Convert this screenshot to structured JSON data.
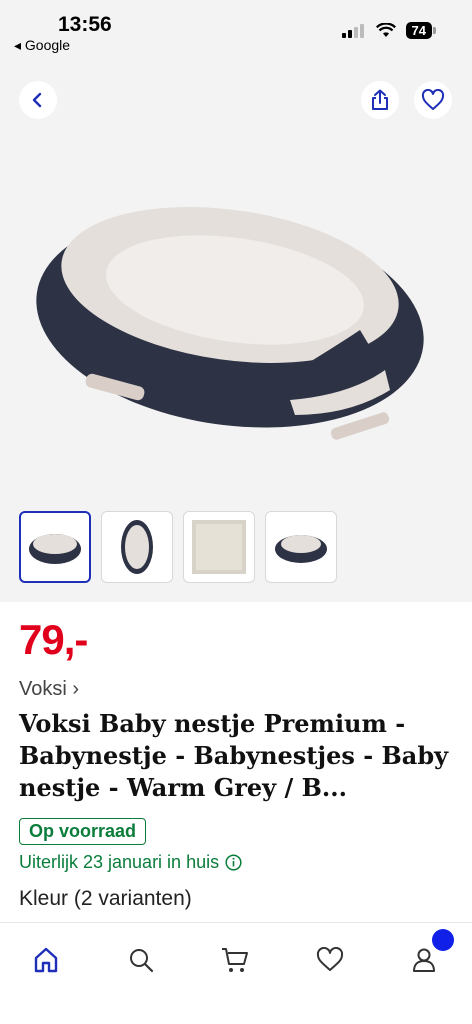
{
  "status": {
    "time": "13:56",
    "back_app": "◂ Google",
    "battery": "74"
  },
  "product": {
    "price": "79,-",
    "brand": "Voksi ›",
    "title": "Voksi Baby nestje Premium - Babynestje - Babynestjes - Baby nestje - Warm Grey / B...",
    "stock": "Op voorraad",
    "delivery": "Uiterlijk 23 januari in huis",
    "variants": "Kleur (2 varianten)",
    "thumbnails_count": 4,
    "selected_thumbnail": 1
  },
  "colors": {
    "price": "#e0001b",
    "accent": "#1f2fb8",
    "stock": "#0a7d3b",
    "notification_dot": "#1020e8"
  },
  "nav": {
    "items": [
      "home-icon",
      "search-icon",
      "cart-icon",
      "heart-icon",
      "account-icon"
    ],
    "active": "home-icon"
  }
}
